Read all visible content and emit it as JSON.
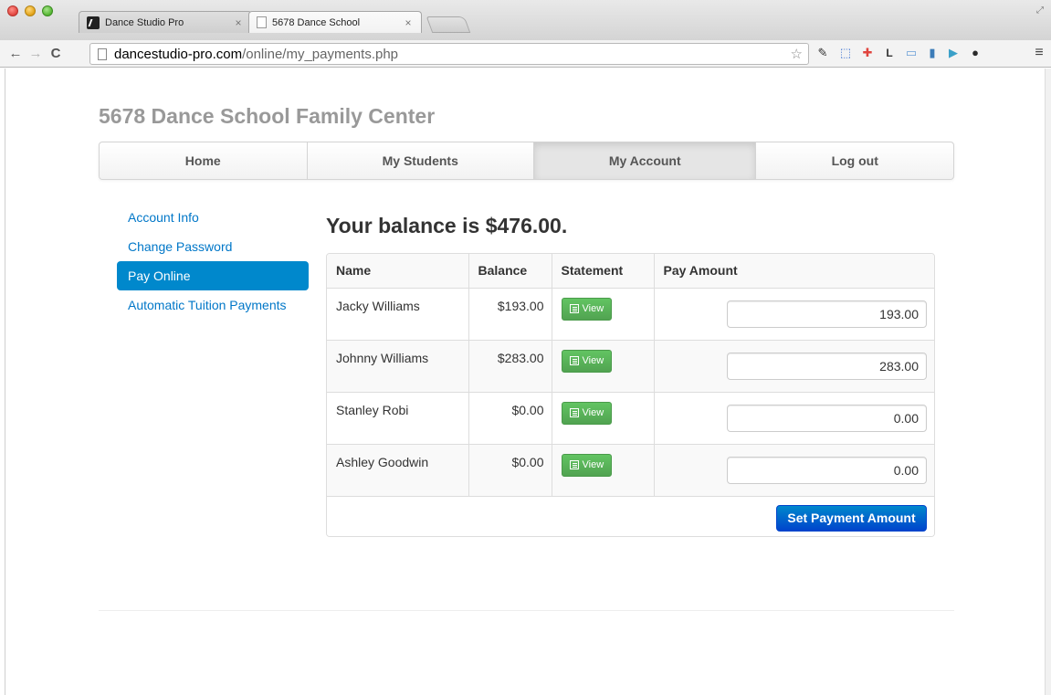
{
  "browser": {
    "tabs": [
      {
        "title": "Dance Studio Pro",
        "close": "×",
        "active": false
      },
      {
        "title": "5678 Dance School",
        "close": "×",
        "active": true
      }
    ],
    "url_host": "dancestudio-pro.com",
    "url_path": "/online/my_payments.php",
    "nav": {
      "back": "←",
      "forward": "→",
      "reload": "C"
    },
    "star": "☆",
    "menu": "≡"
  },
  "site": {
    "title": "5678 Dance School Family Center"
  },
  "topnav": {
    "items": [
      {
        "label": "Home"
      },
      {
        "label": "My Students"
      },
      {
        "label": "My Account",
        "active": true
      },
      {
        "label": "Log out"
      }
    ]
  },
  "sidebar": {
    "items": [
      {
        "label": "Account Info"
      },
      {
        "label": "Change Password"
      },
      {
        "label": "Pay Online",
        "active": true
      },
      {
        "label": "Automatic Tuition Payments"
      }
    ]
  },
  "main": {
    "heading": "Your balance is $476.00.",
    "columns": [
      "Name",
      "Balance",
      "Statement",
      "Pay Amount"
    ],
    "rows": [
      {
        "name": "Jacky Williams",
        "balance": "$193.00",
        "statement": "View",
        "pay": "193.00"
      },
      {
        "name": "Johnny Williams",
        "balance": "$283.00",
        "statement": "View",
        "pay": "283.00"
      },
      {
        "name": "Stanley Robi",
        "balance": "$0.00",
        "statement": "View",
        "pay": "0.00"
      },
      {
        "name": "Ashley Goodwin",
        "balance": "$0.00",
        "statement": "View",
        "pay": "0.00"
      }
    ],
    "submit_label": "Set Payment Amount"
  },
  "colors": {
    "accent": "#0088cc",
    "success": "#5bb75b",
    "link": "#0077c8"
  }
}
